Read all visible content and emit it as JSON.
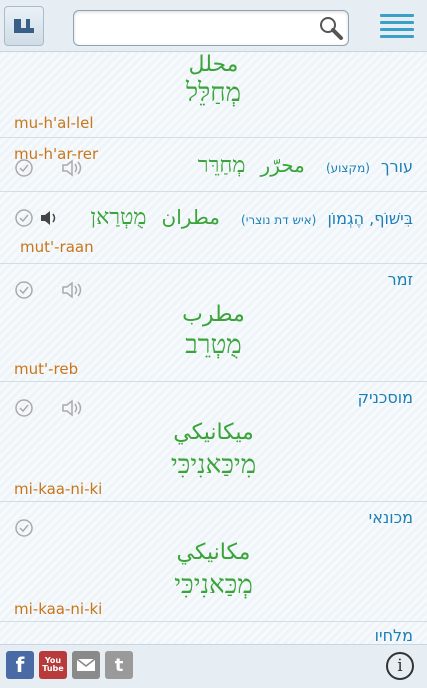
{
  "search": {
    "value": "",
    "placeholder": ""
  },
  "icons": {
    "bookmark": "bookmark-icon",
    "search": "search-icon",
    "menu": "hamburger-menu-icon",
    "check": "check-circle-icon",
    "speaker": "speaker-icon",
    "facebook": "facebook-icon",
    "youtube": "youtube-icon",
    "email": "email-icon",
    "tumblr": "tumblr-icon",
    "info": "info-icon"
  },
  "colors": {
    "hebrew_head": "#1d7fb5",
    "translation_green": "#3aa43a",
    "transliteration": "#c8761a",
    "menu_blue": "#3aa0c8"
  },
  "entries": [
    {
      "arabic": "محلل",
      "hebrew_vocalized": "מְחַלֵּל",
      "transliteration": "mu-h'al-lel"
    },
    {
      "hebrew": "עורך",
      "note": "(מקצוע)",
      "arabic": "محرّر",
      "hebrew_vocalized": "מְחַרֵּר",
      "transliteration": "mu-h'ar-rer"
    },
    {
      "hebrew": "בִּישׁוֹף, הֶגְמוֹן",
      "note": "(איש דת נוצרי)",
      "arabic": "مطران",
      "hebrew_vocalized": "מֻטְרַאן",
      "transliteration": "mut'-raan"
    },
    {
      "hebrew": "זמר",
      "arabic": "مطرب",
      "hebrew_vocalized": "מֻטְרֵב",
      "transliteration": "mut'-reb"
    },
    {
      "hebrew": "מוסכניק",
      "arabic": "ميكانيكي",
      "hebrew_vocalized": "מִיכַּאנִיכִּי",
      "transliteration": "mi-kaa-ni-ki"
    },
    {
      "hebrew": "מכונאי",
      "arabic": "مكانيكي",
      "hebrew_vocalized": "מְכַּאנִיכִּי",
      "transliteration": "mi-kaa-ni-ki"
    },
    {
      "hebrew": "מלחיו"
    }
  ],
  "footer": {
    "info_label": "i",
    "youtube_label": "You Tube",
    "tumblr_label": "t"
  }
}
